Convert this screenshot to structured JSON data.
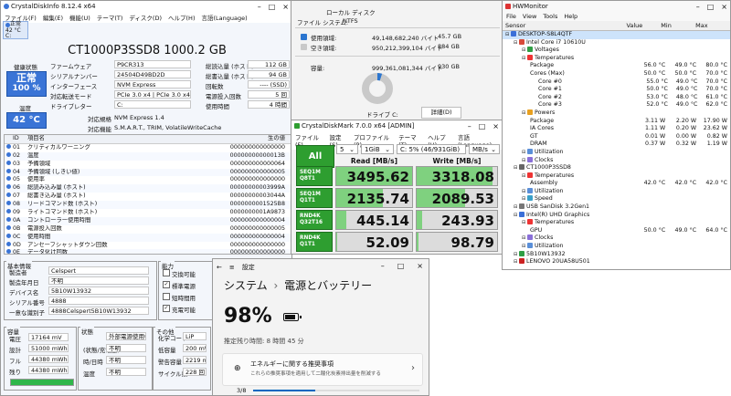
{
  "cdi": {
    "title": "CrystalDiskInfo 8.12.4 x64",
    "menu": [
      "ファイル(F)",
      "編集(E)",
      "機能(U)",
      "テーマ(T)",
      "ディスク(D)",
      "ヘルプ(H)",
      "言語(Language)"
    ],
    "disk_tab": {
      "status": "正常",
      "temp": "42 °C",
      "letter": "C:"
    },
    "model": "CT1000P3SSD8 1000.2 GB",
    "health_label": "健康状態",
    "health_status": "正常",
    "health_percent": "100 %",
    "temp_label": "温度",
    "temp_value": "42 °C",
    "left_fields": [
      {
        "label": "ファームウェア",
        "value": "P9CR313"
      },
      {
        "label": "シリアルナンバー",
        "value": "24504D49BD2D"
      },
      {
        "label": "インターフェース",
        "value": "NVM Express"
      },
      {
        "label": "対応転送モード",
        "value": "PCIe 3.0 x4 | PCIe 3.0 x4"
      },
      {
        "label": "ドライブレター",
        "value": "C:"
      }
    ],
    "right_fields": [
      {
        "label": "総読込量 (ホスト)",
        "value": "112 GB"
      },
      {
        "label": "総書込量 (ホスト)",
        "value": "94 GB"
      },
      {
        "label": "回転数",
        "value": "---- (SSD)"
      },
      {
        "label": "電源投入回数",
        "value": "5 回"
      },
      {
        "label": "使用時間",
        "value": "4 時間"
      }
    ],
    "standard_label": "対応規格",
    "standard_value": "NVM Express 1.4",
    "features_label": "対応機能",
    "features_value": "S.M.A.R.T., TRIM, VolatileWriteCache",
    "smart_headers": [
      "ID",
      "項目名",
      "生の値"
    ],
    "smart_rows": [
      {
        "id": "01",
        "name": "クリティカルワーニング",
        "raw": "000000000000000"
      },
      {
        "id": "02",
        "name": "温度",
        "raw": "00000000000013B"
      },
      {
        "id": "03",
        "name": "予備領域",
        "raw": "000000000000064"
      },
      {
        "id": "04",
        "name": "予備領域 (しきい値)",
        "raw": "000000000000005"
      },
      {
        "id": "05",
        "name": "使用率",
        "raw": "000000000000000"
      },
      {
        "id": "06",
        "name": "総読み込み量 (ホスト)",
        "raw": "00000000003999A"
      },
      {
        "id": "07",
        "name": "総書き込み量 (ホスト)",
        "raw": "00000000003044A"
      },
      {
        "id": "08",
        "name": "リードコマンド数 (ホスト)",
        "raw": "0000000001525B8"
      },
      {
        "id": "09",
        "name": "ライトコマンド数 (ホスト)",
        "raw": "0000000001A9873"
      },
      {
        "id": "0A",
        "name": "コントローラー使用時間",
        "raw": "000000000000004"
      },
      {
        "id": "0B",
        "name": "電源投入回数",
        "raw": "000000000000005"
      },
      {
        "id": "0C",
        "name": "使用時間",
        "raw": "000000000000004"
      },
      {
        "id": "0D",
        "name": "アンセーフシャットダウン回数",
        "raw": "000000000000000"
      },
      {
        "id": "0E",
        "name": "データ化け回数",
        "raw": "000000000000000"
      },
      {
        "id": "0F",
        "name": "エラーログエントリー数",
        "raw": "000000000000000"
      }
    ],
    "basic": {
      "title": "基本情報",
      "rows": [
        {
          "label": "製造者",
          "value": "Celspert"
        },
        {
          "label": "製造年月日",
          "value": "不明"
        },
        {
          "label": "デバイス名",
          "value": "5B10W13932"
        },
        {
          "label": "シリアル番号",
          "value": "4888"
        },
        {
          "label": "一意な識別子",
          "value": "4888Celspert5B10W13932"
        }
      ]
    },
    "capability": {
      "title": "能力",
      "items": [
        {
          "label": "交換可能",
          "checked": false
        },
        {
          "label": "標準電源",
          "checked": true
        },
        {
          "label": "短時間用",
          "checked": false
        },
        {
          "label": "充電可能",
          "checked": true
        }
      ]
    },
    "capacity": {
      "title": "容量",
      "rows": [
        {
          "label": "電圧",
          "value": "17164 mV"
        },
        {
          "label": "設計",
          "value": "51000 mWh"
        },
        {
          "label": "フル",
          "value": "44380 mWh"
        },
        {
          "label": "残り",
          "value": "44380 mWh"
        }
      ]
    },
    "state": {
      "title": "状態",
      "rows": [
        {
          "label": "",
          "value": "外部電源使用中"
        },
        {
          "label": "(状態/充電量)",
          "value": "不明"
        },
        {
          "label": "時/日時",
          "value": "不明"
        },
        {
          "label": "温度",
          "value": "不明"
        }
      ]
    },
    "other": {
      "title": "その他",
      "rows": [
        {
          "label": "化学コード",
          "value": "LiP"
        },
        {
          "label": "低容量",
          "value": "200 mWh"
        },
        {
          "label": "警告容量",
          "value": "2219 mWh"
        },
        {
          "label": "サイクル数",
          "value": "228 回"
        }
      ]
    },
    "charge_fraction": 1.0
  },
  "props": {
    "fs_label": "ファイル システム:",
    "fs_value": "NTFS",
    "disk_type": "ローカル ディスク",
    "used_label": "使用領域:",
    "used_bytes": "49,148,682,240 バイト",
    "used_size": "45.7 GB",
    "free_label": "空き領域:",
    "free_bytes": "950,212,399,104 バイト",
    "free_size": "884 GB",
    "cap_label": "容量:",
    "cap_bytes": "999,361,081,344 バイト",
    "cap_size": "930 GB",
    "drive_label": "ドライブ C:",
    "detail_button": "詳細(D)",
    "used_fraction": 0.049,
    "used_color": "#2b75cf",
    "free_color": "#c9c9c9"
  },
  "hwm": {
    "title": "HWMonitor",
    "menu": [
      "File",
      "View",
      "Tools",
      "Help"
    ],
    "headers": [
      "Sensor",
      "Value",
      "Min",
      "Max"
    ],
    "rows": [
      {
        "indent": 0,
        "icon": "computer-icon",
        "label": "DESKTOP-S8L4QTF",
        "v": "",
        "mn": "",
        "mx": "",
        "sel": true
      },
      {
        "indent": 1,
        "icon": "cpu-icon",
        "label": "Intel Core i7 10610U",
        "v": "",
        "mn": "",
        "mx": ""
      },
      {
        "indent": 2,
        "icon": "voltage-icon",
        "label": "Voltages",
        "v": "",
        "mn": "",
        "mx": ""
      },
      {
        "indent": 2,
        "icon": "thermometer-icon",
        "label": "Temperatures",
        "v": "",
        "mn": "",
        "mx": ""
      },
      {
        "indent": 3,
        "icon": "",
        "label": "Package",
        "v": "56.0 °C",
        "mn": "49.0 °C",
        "mx": "80.0 °C"
      },
      {
        "indent": 3,
        "icon": "",
        "label": "Cores (Max)",
        "v": "50.0 °C",
        "mn": "50.0 °C",
        "mx": "70.0 °C"
      },
      {
        "indent": 4,
        "icon": "",
        "label": "Core #0",
        "v": "55.0 °C",
        "mn": "49.0 °C",
        "mx": "70.0 °C"
      },
      {
        "indent": 4,
        "icon": "",
        "label": "Core #1",
        "v": "50.0 °C",
        "mn": "49.0 °C",
        "mx": "70.0 °C"
      },
      {
        "indent": 4,
        "icon": "",
        "label": "Core #2",
        "v": "53.0 °C",
        "mn": "48.0 °C",
        "mx": "61.0 °C"
      },
      {
        "indent": 4,
        "icon": "",
        "label": "Core #3",
        "v": "52.0 °C",
        "mn": "49.0 °C",
        "mx": "62.0 °C"
      },
      {
        "indent": 2,
        "icon": "power-icon",
        "label": "Powers",
        "v": "",
        "mn": "",
        "mx": ""
      },
      {
        "indent": 3,
        "icon": "",
        "label": "Package",
        "v": "3.11 W",
        "mn": "2.20 W",
        "mx": "17.90 W"
      },
      {
        "indent": 3,
        "icon": "",
        "label": "IA Cores",
        "v": "1.11 W",
        "mn": "0.20 W",
        "mx": "23.62 W"
      },
      {
        "indent": 3,
        "icon": "",
        "label": "GT",
        "v": "0.01 W",
        "mn": "0.00 W",
        "mx": "0.82 W"
      },
      {
        "indent": 3,
        "icon": "",
        "label": "DRAM",
        "v": "0.37 W",
        "mn": "0.32 W",
        "mx": "1.19 W"
      },
      {
        "indent": 2,
        "icon": "utilization-icon",
        "label": "Utilization",
        "v": "",
        "mn": "",
        "mx": ""
      },
      {
        "indent": 2,
        "icon": "clock-icon",
        "label": "Clocks",
        "v": "",
        "mn": "",
        "mx": ""
      },
      {
        "indent": 1,
        "icon": "drive-icon",
        "label": "CT1000P3SSD8",
        "v": "",
        "mn": "",
        "mx": ""
      },
      {
        "indent": 2,
        "icon": "thermometer-icon",
        "label": "Temperatures",
        "v": "",
        "mn": "",
        "mx": ""
      },
      {
        "indent": 3,
        "icon": "",
        "label": "Assembly",
        "v": "42.0 °C",
        "mn": "42.0 °C",
        "mx": "42.0 °C"
      },
      {
        "indent": 2,
        "icon": "utilization-icon",
        "label": "Utilization",
        "v": "",
        "mn": "",
        "mx": ""
      },
      {
        "indent": 2,
        "icon": "speed-icon",
        "label": "Speed",
        "v": "",
        "mn": "",
        "mx": ""
      },
      {
        "indent": 1,
        "icon": "usb-icon",
        "label": "USB  SanDisk 3.2Gen1",
        "v": "",
        "mn": "",
        "mx": ""
      },
      {
        "indent": 1,
        "icon": "gpu-icon",
        "label": "Intel(R) UHD Graphics",
        "v": "",
        "mn": "",
        "mx": ""
      },
      {
        "indent": 2,
        "icon": "thermometer-icon",
        "label": "Temperatures",
        "v": "",
        "mn": "",
        "mx": ""
      },
      {
        "indent": 3,
        "icon": "",
        "label": "GPU",
        "v": "50.0 °C",
        "mn": "49.0 °C",
        "mx": "64.0 °C"
      },
      {
        "indent": 2,
        "icon": "clock-icon",
        "label": "Clocks",
        "v": "",
        "mn": "",
        "mx": ""
      },
      {
        "indent": 2,
        "icon": "utilization-icon",
        "label": "Utilization",
        "v": "",
        "mn": "",
        "mx": ""
      },
      {
        "indent": 1,
        "icon": "battery-icon",
        "label": "5B10W13932",
        "v": "",
        "mn": "",
        "mx": ""
      },
      {
        "indent": 1,
        "icon": "lenovo-icon",
        "label": "LENOVO 20UA58U501",
        "v": "",
        "mn": "",
        "mx": ""
      }
    ]
  },
  "cdm": {
    "title": "CrystalDiskMark 7.0.0 x64 [ADMIN]",
    "menu": [
      "ファイル(F)",
      "設定(S)",
      "プロファイル(P)",
      "テーマ(T)",
      "ヘルプ(H)",
      "言語(Language)"
    ],
    "all_label": "All",
    "count": "5",
    "size": "1GiB",
    "drive": "C: 5% (46/931GiB)",
    "unit": "MB/s",
    "read_header": "Read [MB/s]",
    "write_header": "Write [MB/s]",
    "max_scale": 3500,
    "tests": [
      {
        "l1": "SEQ1M",
        "l2": "Q8T1",
        "read": "3495.62",
        "write": "3318.08",
        "rv": 3495.62,
        "wv": 3318.08
      },
      {
        "l1": "SEQ1M",
        "l2": "Q1T1",
        "read": "2135.74",
        "write": "2089.53",
        "rv": 2135.74,
        "wv": 2089.53
      },
      {
        "l1": "RND4K",
        "l2": "Q32T16",
        "read": "445.14",
        "write": "243.93",
        "rv": 445.14,
        "wv": 243.93
      },
      {
        "l1": "RND4K",
        "l2": "Q1T1",
        "read": "52.09",
        "write": "98.79",
        "rv": 52.09,
        "wv": 98.79
      }
    ]
  },
  "ws": {
    "app_name": "設定",
    "breadcrumb_parent": "システム",
    "breadcrumb_sep": "›",
    "page_title": "電源とバッテリー",
    "battery_percent": "98%",
    "remaining": "推定残り時間: 8 時間 45 分",
    "battery_fraction": 0.98,
    "card_title": "エネルギーに関する推奨事項",
    "card_subtitle": "これらの推奨事項を適用して二酸化炭素排出量を削減する",
    "card_progress": "3/8"
  }
}
